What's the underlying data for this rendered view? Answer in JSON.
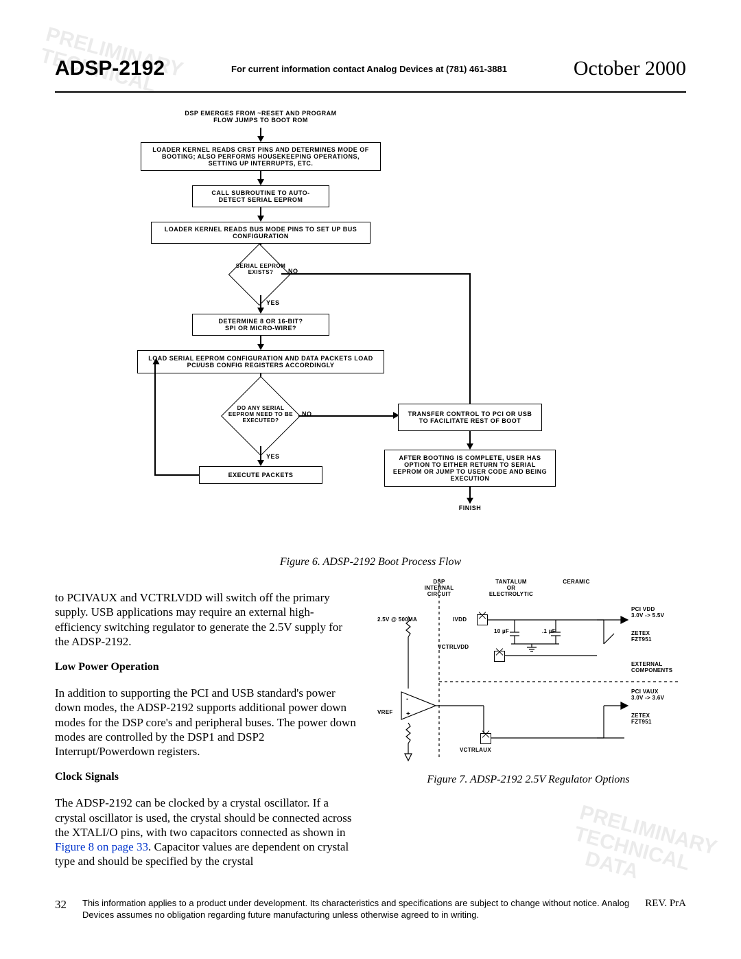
{
  "header": {
    "left": "ADSP-2192",
    "center": "For current information contact Analog Devices at (781) 461-3881",
    "right": "October 2000"
  },
  "watermark_top": "PRELIMINARY\nTECHNICAL",
  "watermark_bottom": "PRELIMINARY\nTECHNICAL\n   DATA",
  "diagram": {
    "step1": "DSP EMERGES FROM ~RESET AND PROGRAM FLOW JUMPS TO BOOT ROM",
    "step2": "LOADER KERNEL READS CRST PINS AND DETERMINES MODE OF BOOTING; ALSO PERFORMS HOUSEKEEPING OPERATIONS, SETTING UP INTERRUPTS, ETC.",
    "step3": "CALL SUBROUTINE TO AUTO-DETECT SERIAL EEPROM",
    "step4": "LOADER KERNEL READS BUS MODE PINS TO SET UP BUS CONFIGURATION",
    "dec1": "SERIAL EEPROM EXISTS?",
    "dec1_no": "NO",
    "dec1_yes": "YES",
    "step5": "DETERMINE 8 OR 16-BIT?\nSPI OR MICRO-WIRE?",
    "step6": "LOAD SERIAL EEPROM CONFIGURATION AND DATA PACKETS LOAD PCI/USB CONFIG REGISTERS ACCORDINGLY",
    "dec2": "DO ANY SERIAL EEPROM NEED TO BE EXECUTED?",
    "dec2_no": "NO",
    "dec2_yes": "YES",
    "step7": "EXECUTE PACKETS",
    "step8": "TRANSFER CONTROL TO PCI OR USB TO FACILITATE REST OF  BOOT",
    "step9": "AFTER BOOTING  IS COMPLETE, USER HAS  OPTION TO EITHER RETURN TO SERIAL EEPROM  OR JUMP TO USER CODE AND BEING EXECUTION",
    "finish": "FINISH"
  },
  "figure6_caption": "Figure 6.  ADSP-2192 Boot Process Flow",
  "body": {
    "p1": "to PCIVAUX and VCTRLVDD will switch off the primary supply. USB applications may require an external high-efficiency switching regulator to generate the 2.5V supply for the ADSP-2192.",
    "h1": "Low Power Operation",
    "p2": "In addition to supporting the PCI and USB standard's power down modes, the ADSP-2192 supports additional power down modes for the DSP core's and peripheral buses. The power down modes are controlled by the DSP1 and DSP2 Interrupt/Powerdown registers.",
    "h2": "Clock Signals",
    "p3_a": "The ADSP-2192 can be clocked by a crystal oscillator. If a crystal oscillator is used, the crystal should be connected across the XTALI/O pins, with two capacitors connected as shown in ",
    "p3_link": "Figure 8 on page 33",
    "p3_b": ". Capacitor values are dependent on crystal type and should be specified by the crystal"
  },
  "circuit": {
    "dsp": "DSP\nINTERNAL\nCIRCUIT",
    "tantalum": "TANTALUM\nOR\nELECTROLYTIC",
    "ceramic": "CERAMIC",
    "vspec": "2.5V @ 500MA",
    "ivdd": "IVDD",
    "cap1": "10 µF",
    "cap2": ".1 µF",
    "pcivdd": "PCI VDD\n3.0V -> 5.5V",
    "zetex1": "ZETEX\nFZT951",
    "vctrlvdd": "VCTRLVDD",
    "ext": "EXTERNAL\nCOMPONENTS",
    "pcivaux": "PCI VAUX\n3.0V -> 3.6V",
    "zetex2": "ZETEX\nFZT951",
    "vref": "VREF",
    "vctrlaux": "VCTRLAUX"
  },
  "figure7_caption": "Figure 7.  ADSP-2192 2.5V Regulator Options",
  "footer": {
    "page": "32",
    "text": "This information applies to a product under development. Its characteristics and specifications are subject to change without notice. Analog Devices assumes no obligation regarding future manufacturing unless otherwise agreed to in writing.",
    "rev": "REV. PrA"
  }
}
